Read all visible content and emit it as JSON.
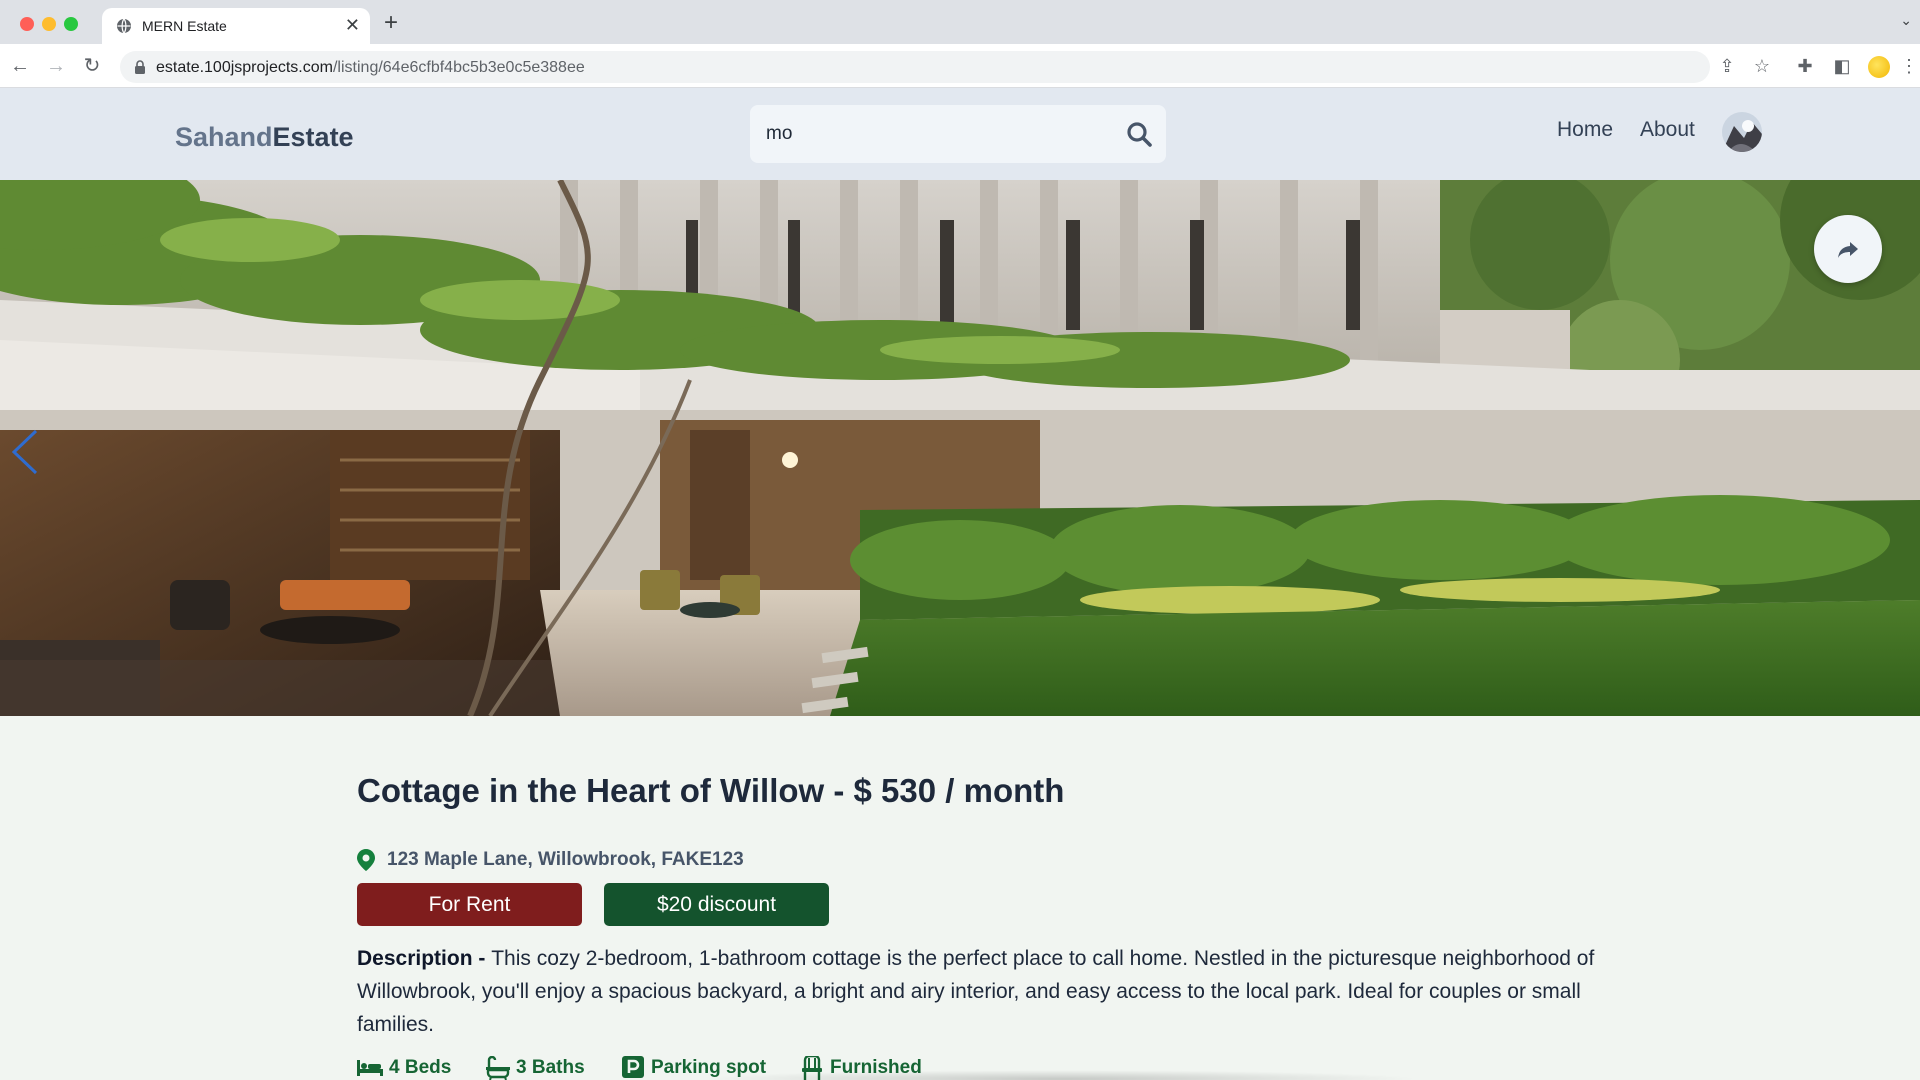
{
  "browser": {
    "tab_title": "MERN Estate",
    "url_host": "estate.100jsprojects.com",
    "url_path": "/listing/64e6cfbf4bc5b3e0c5e388ee"
  },
  "header": {
    "logo_part1": "Sahand",
    "logo_part2": "Estate",
    "search_value": "mo",
    "nav": {
      "home": "Home",
      "about": "About"
    }
  },
  "listing": {
    "title": "Cottage in the Heart of Willow - $ 530 / month",
    "address": "123 Maple Lane, Willowbrook, FAKE123",
    "badge_type": "For Rent",
    "badge_discount": "$20 discount",
    "description_label": "Description - ",
    "description": "This cozy 2-bedroom, 1-bathroom cottage is the perfect place to call home. Nestled in the picturesque neighborhood of Willowbrook, you'll enjoy a spacious backyard, a bright and airy interior, and easy access to the local park. Ideal for couples or small families.",
    "features": {
      "beds": "4 Beds",
      "baths": "3 Baths",
      "parking": "Parking spot",
      "furnished": "Furnished"
    }
  },
  "colors": {
    "header_bg": "#e2e8f0",
    "page_bg": "#f1f5f1",
    "rent_badge": "#7f1d1d",
    "discount_badge": "#14532d",
    "feature_green": "#166534"
  },
  "icons": [
    "globe-icon",
    "close-icon",
    "plus-icon",
    "back-icon",
    "forward-icon",
    "reload-icon",
    "lock-icon",
    "share-page-icon",
    "star-icon",
    "puzzle-icon",
    "sidepanel-icon",
    "search-icon",
    "chevron-left-icon",
    "share-icon",
    "map-pin-icon",
    "bed-icon",
    "bath-icon",
    "parking-icon",
    "chair-icon"
  ]
}
